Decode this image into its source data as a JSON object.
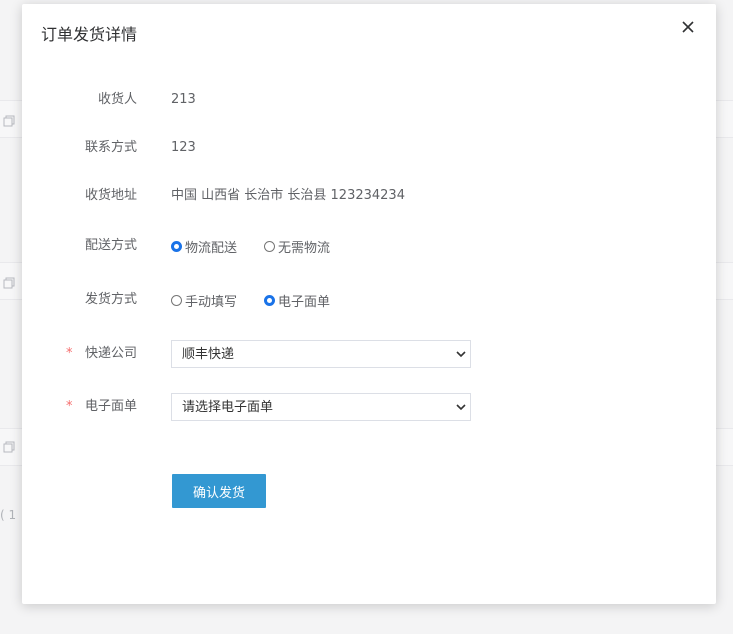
{
  "dialog": {
    "title": "订单发货详情"
  },
  "fields": {
    "receiver": {
      "label": "收货人",
      "value": "213"
    },
    "contact": {
      "label": "联系方式",
      "value": "123"
    },
    "address": {
      "label": "收货地址",
      "value": "中国 山西省 长治市 长治县 123234234"
    },
    "delivery_method": {
      "label": "配送方式",
      "options": [
        "物流配送",
        "无需物流"
      ],
      "selected": "物流配送"
    },
    "shipping_method": {
      "label": "发货方式",
      "options": [
        "手动填写",
        "电子面单"
      ],
      "selected": "电子面单"
    },
    "courier": {
      "label": "快递公司",
      "required_mark": "*",
      "value": "顺丰快递"
    },
    "waybill": {
      "label": "电子面单",
      "required_mark": "*",
      "value": "请选择电子面单"
    }
  },
  "actions": {
    "confirm_label": "确认发货"
  },
  "background": {
    "pagination_text": "( 1"
  },
  "colors": {
    "primary_button": "#3398d2",
    "radio_checked": "#1a73e8",
    "required": "#f56c6c"
  }
}
